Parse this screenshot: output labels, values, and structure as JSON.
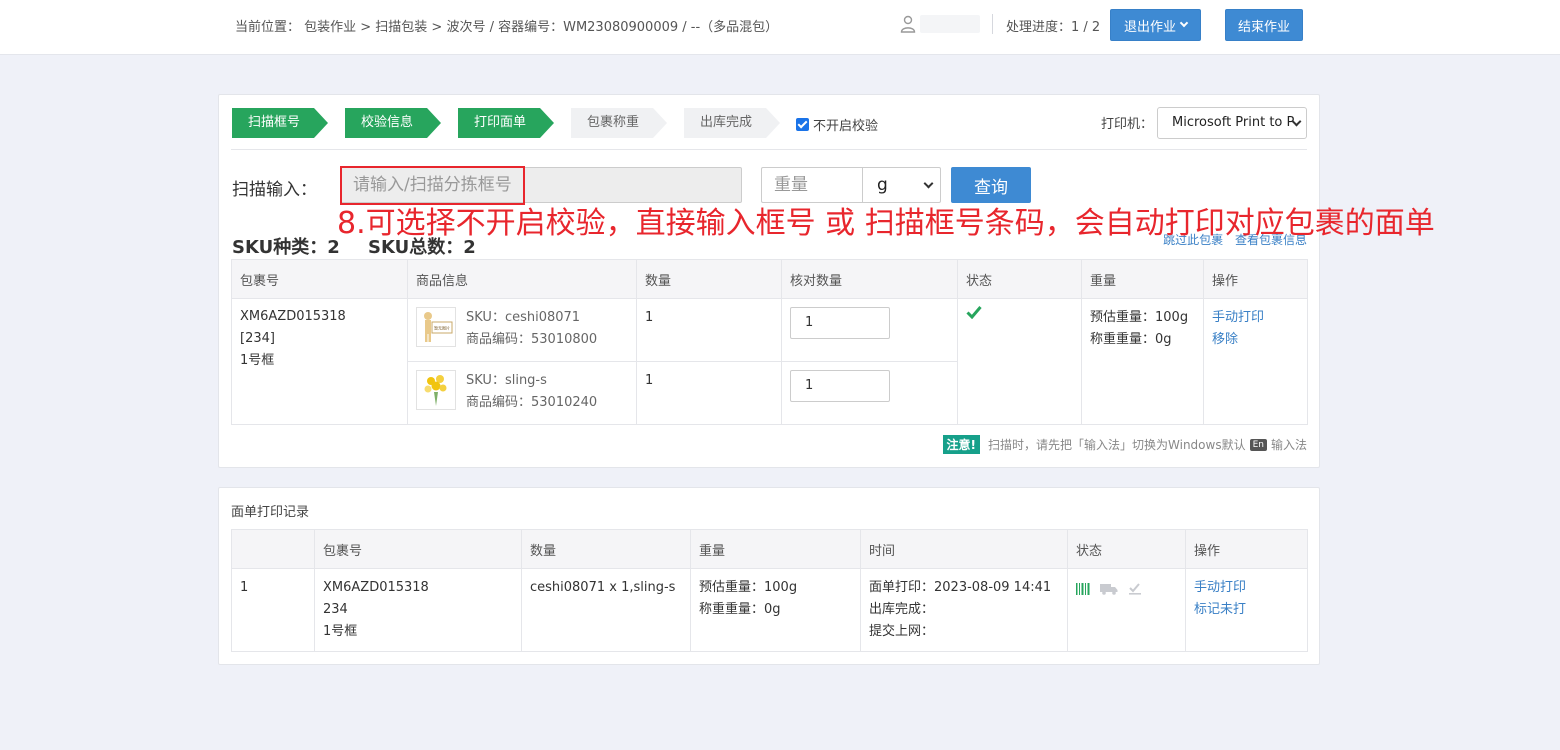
{
  "topbar": {
    "breadcrumb": "当前位置： 包装作业 > 扫描包装 > 波次号 / 容器编号：WM23080900009 / --（多品混包）",
    "progress": "处理进度：1 / 2",
    "exit_label": "退出作业",
    "end_label": "结束作业"
  },
  "steps": [
    "扫描框号",
    "校验信息",
    "打印面单",
    "包裹称重",
    "出库完成"
  ],
  "no_verify_label": "不开启校验",
  "printer": {
    "label": "打印机：",
    "value": "Microsoft Print to P"
  },
  "scan": {
    "label": "扫描输入：",
    "placeholder": "请输入/扫描分拣框号",
    "weight_placeholder": "重量",
    "unit": "g",
    "query_label": "查询"
  },
  "annotation": "8.可选择不开启校验，直接输入框号 或 扫描框号条码，会自动打印对应包裹的面单",
  "summary": {
    "sku_types": "SKU种类：2",
    "sku_total": "SKU总数：2",
    "link_skip": "跳过此包裹",
    "link_view": "查看包裹信息"
  },
  "pkg_table": {
    "headers": [
      "包裹号",
      "商品信息",
      "数量",
      "核对数量",
      "状态",
      "重量",
      "操作"
    ],
    "package": {
      "line1": "XM6AZD015318",
      "line2": "[234]",
      "line3": "1号框"
    },
    "items": [
      {
        "sku": "SKU：ceshi08071",
        "code": "商品编码：53010800",
        "qty": "1",
        "check_qty": "1"
      },
      {
        "sku": "SKU：sling-s",
        "code": "商品编码：53010240",
        "qty": "1",
        "check_qty": "1"
      }
    ],
    "weight_est": "预估重量：100g",
    "weight_actual": "称重重量：0g",
    "action_print": "手动打印",
    "action_remove": "移除",
    "thumb_text": "暂无图片"
  },
  "notice": {
    "badge": "注意!",
    "text_before": "扫描时，请先把「输入法」切换为Windows默认",
    "en": "En",
    "text_after": "输入法"
  },
  "log": {
    "title": "面单打印记录",
    "headers": [
      "",
      "包裹号",
      "数量",
      "重量",
      "时间",
      "状态",
      "操作"
    ],
    "row": {
      "index": "1",
      "pkg1": "XM6AZD015318",
      "pkg2": "234",
      "pkg3": "1号框",
      "qty": "ceshi08071 x 1,sling-s",
      "weight_est": "预估重量：100g",
      "weight_actual": "称重重量：0g",
      "time_print": "面单打印：2023-08-09 14:41",
      "time_out": "出库完成：",
      "time_submit": "提交上网：",
      "action_print": "手动打印",
      "action_mark": "标记未打"
    }
  }
}
